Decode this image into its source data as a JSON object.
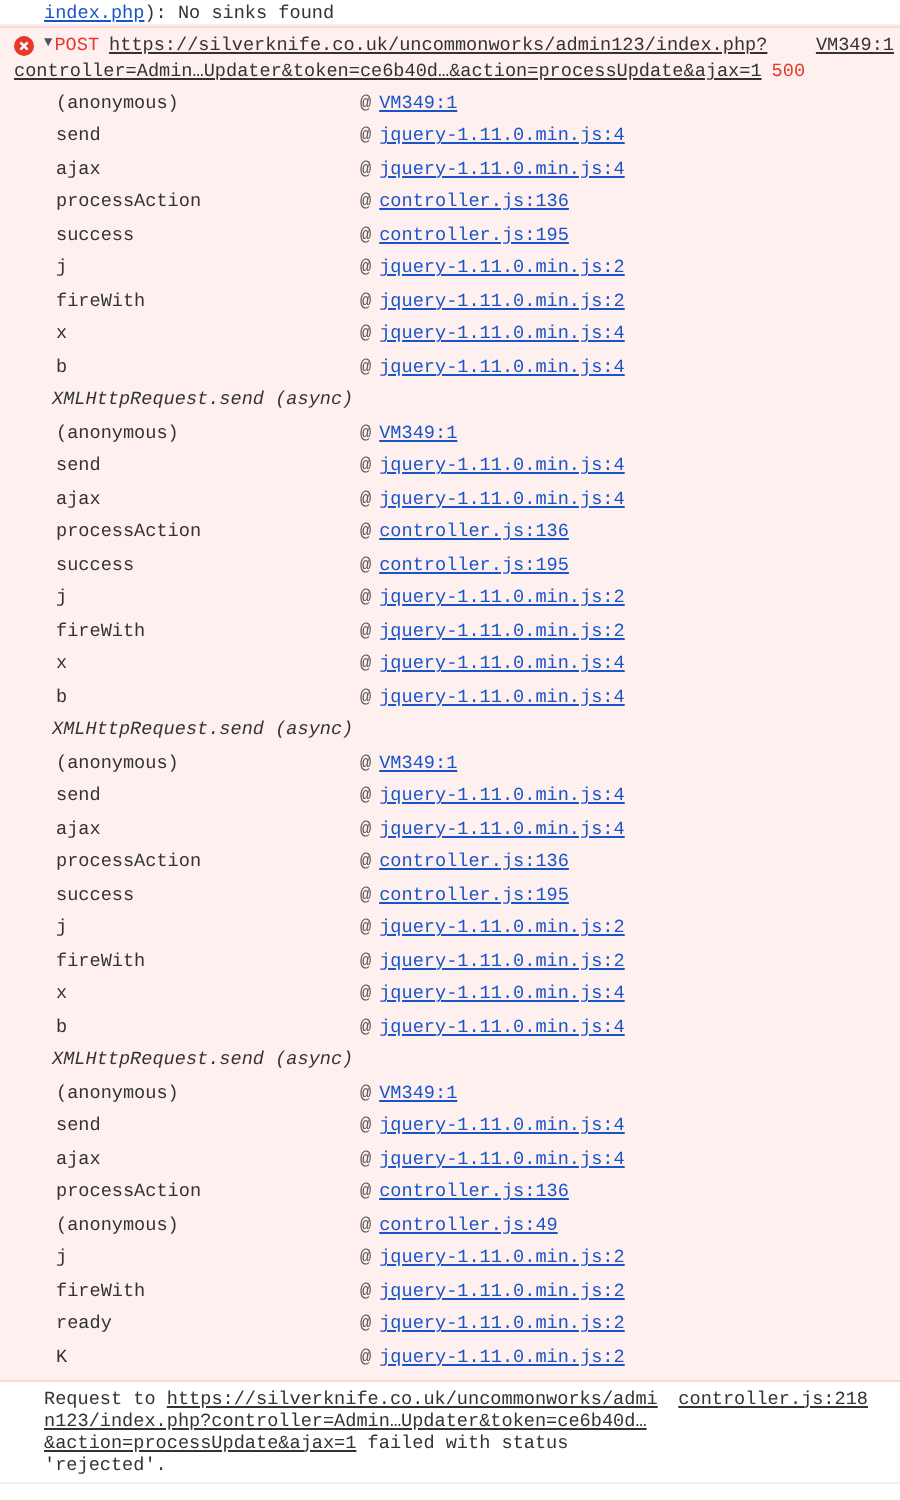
{
  "previous_message": {
    "link": "index.php",
    "text": "): No sinks found"
  },
  "error": {
    "expanded": true,
    "toggle": "▼",
    "method": "POST",
    "url_parts": [
      "https://silverknife.co.uk/uncommonworks/admin123/index.php?",
      "controller=Admin…Updater&token=ce6b40d…&action=processUpdate&ajax=1"
    ],
    "source": "VM349:1",
    "status": "500",
    "stack": [
      {
        "kind": "frame",
        "name": "(anonymous)",
        "location": "VM349:1"
      },
      {
        "kind": "frame",
        "name": "send",
        "location": "jquery-1.11.0.min.js:4"
      },
      {
        "kind": "frame",
        "name": "ajax",
        "location": "jquery-1.11.0.min.js:4"
      },
      {
        "kind": "frame",
        "name": "processAction",
        "location": "controller.js:136"
      },
      {
        "kind": "frame",
        "name": "success",
        "location": "controller.js:195"
      },
      {
        "kind": "frame",
        "name": "j",
        "location": "jquery-1.11.0.min.js:2"
      },
      {
        "kind": "frame",
        "name": "fireWith",
        "location": "jquery-1.11.0.min.js:2"
      },
      {
        "kind": "frame",
        "name": "x",
        "location": "jquery-1.11.0.min.js:4"
      },
      {
        "kind": "frame",
        "name": "b",
        "location": "jquery-1.11.0.min.js:4"
      },
      {
        "kind": "async",
        "name": "XMLHttpRequest.send (async)"
      },
      {
        "kind": "frame",
        "name": "(anonymous)",
        "location": "VM349:1"
      },
      {
        "kind": "frame",
        "name": "send",
        "location": "jquery-1.11.0.min.js:4"
      },
      {
        "kind": "frame",
        "name": "ajax",
        "location": "jquery-1.11.0.min.js:4"
      },
      {
        "kind": "frame",
        "name": "processAction",
        "location": "controller.js:136"
      },
      {
        "kind": "frame",
        "name": "success",
        "location": "controller.js:195"
      },
      {
        "kind": "frame",
        "name": "j",
        "location": "jquery-1.11.0.min.js:2"
      },
      {
        "kind": "frame",
        "name": "fireWith",
        "location": "jquery-1.11.0.min.js:2"
      },
      {
        "kind": "frame",
        "name": "x",
        "location": "jquery-1.11.0.min.js:4"
      },
      {
        "kind": "frame",
        "name": "b",
        "location": "jquery-1.11.0.min.js:4"
      },
      {
        "kind": "async",
        "name": "XMLHttpRequest.send (async)"
      },
      {
        "kind": "frame",
        "name": "(anonymous)",
        "location": "VM349:1"
      },
      {
        "kind": "frame",
        "name": "send",
        "location": "jquery-1.11.0.min.js:4"
      },
      {
        "kind": "frame",
        "name": "ajax",
        "location": "jquery-1.11.0.min.js:4"
      },
      {
        "kind": "frame",
        "name": "processAction",
        "location": "controller.js:136"
      },
      {
        "kind": "frame",
        "name": "success",
        "location": "controller.js:195"
      },
      {
        "kind": "frame",
        "name": "j",
        "location": "jquery-1.11.0.min.js:2"
      },
      {
        "kind": "frame",
        "name": "fireWith",
        "location": "jquery-1.11.0.min.js:2"
      },
      {
        "kind": "frame",
        "name": "x",
        "location": "jquery-1.11.0.min.js:4"
      },
      {
        "kind": "frame",
        "name": "b",
        "location": "jquery-1.11.0.min.js:4"
      },
      {
        "kind": "async",
        "name": "XMLHttpRequest.send (async)"
      },
      {
        "kind": "frame",
        "name": "(anonymous)",
        "location": "VM349:1"
      },
      {
        "kind": "frame",
        "name": "send",
        "location": "jquery-1.11.0.min.js:4"
      },
      {
        "kind": "frame",
        "name": "ajax",
        "location": "jquery-1.11.0.min.js:4"
      },
      {
        "kind": "frame",
        "name": "processAction",
        "location": "controller.js:136"
      },
      {
        "kind": "frame",
        "name": "(anonymous)",
        "location": "controller.js:49"
      },
      {
        "kind": "frame",
        "name": "j",
        "location": "jquery-1.11.0.min.js:2"
      },
      {
        "kind": "frame",
        "name": "fireWith",
        "location": "jquery-1.11.0.min.js:2"
      },
      {
        "kind": "frame",
        "name": "ready",
        "location": "jquery-1.11.0.min.js:2"
      },
      {
        "kind": "frame",
        "name": "K",
        "location": "jquery-1.11.0.min.js:2"
      }
    ]
  },
  "log_message": {
    "before": "Request to ",
    "url_parts": [
      "https://silverknife.co.uk/uncommonworks/admi",
      "n123/index.php?controller=Admin…Updater&token=ce6b40d…",
      "&action=processUpdate&ajax=1"
    ],
    "after": " failed with status 'rejected'.",
    "source": "controller.js:218"
  },
  "at_sign": "@"
}
